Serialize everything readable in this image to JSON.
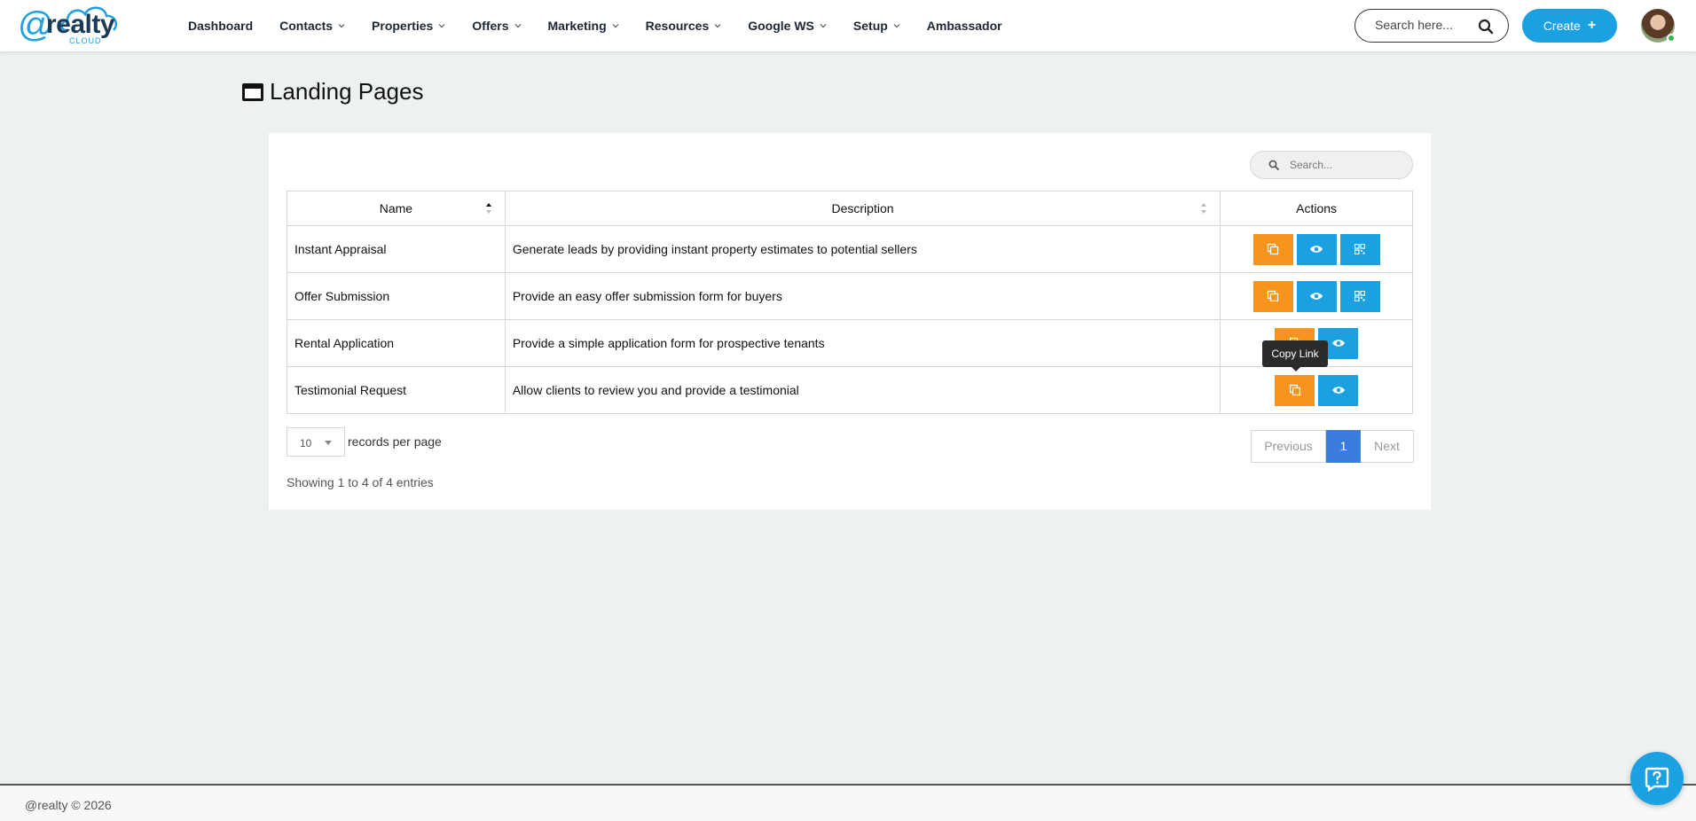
{
  "brand": {
    "logo_at": "@",
    "logo_word": "realty",
    "logo_sub": "CLOUD"
  },
  "nav": [
    {
      "label": "Dashboard",
      "dropdown": false
    },
    {
      "label": "Contacts",
      "dropdown": true
    },
    {
      "label": "Properties",
      "dropdown": true
    },
    {
      "label": "Offers",
      "dropdown": true
    },
    {
      "label": "Marketing",
      "dropdown": true
    },
    {
      "label": "Resources",
      "dropdown": true
    },
    {
      "label": "Google WS",
      "dropdown": true
    },
    {
      "label": "Setup",
      "dropdown": true
    },
    {
      "label": "Ambassador",
      "dropdown": false
    }
  ],
  "header": {
    "search_placeholder": "Search here...",
    "create_label": "Create",
    "create_icon": "+"
  },
  "page": {
    "title": "Landing Pages",
    "title_icon": "window-icon"
  },
  "table": {
    "search_placeholder": "Search...",
    "columns": [
      "Name",
      "Description",
      "Actions"
    ],
    "rows": [
      {
        "name": "Instant Appraisal",
        "description": "Generate leads by providing instant property estimates to potential sellers",
        "actions": [
          "copy-link",
          "view",
          "qr-code"
        ]
      },
      {
        "name": "Offer Submission",
        "description": "Provide an easy offer submission form for buyers",
        "actions": [
          "copy-link",
          "view",
          "qr-code"
        ]
      },
      {
        "name": "Rental Application",
        "description": "Provide a simple application form for prospective tenants",
        "actions": [
          "copy-link",
          "view"
        ]
      },
      {
        "name": "Testimonial Request",
        "description": "Allow clients to review you and provide a testimonial",
        "actions": [
          "copy-link",
          "view"
        ]
      }
    ],
    "tooltip": "Copy Link",
    "page_size": "10",
    "per_page_label": "records per page",
    "showing": "Showing 1 to 4 of 4 entries",
    "pager": {
      "previous": "Previous",
      "current": "1",
      "next": "Next"
    }
  },
  "colors": {
    "accent_blue": "#1ba1e2",
    "accent_orange": "#f7941d",
    "pager_active": "#3b7ddd"
  },
  "footer": {
    "copyright": "@realty © 2026"
  }
}
